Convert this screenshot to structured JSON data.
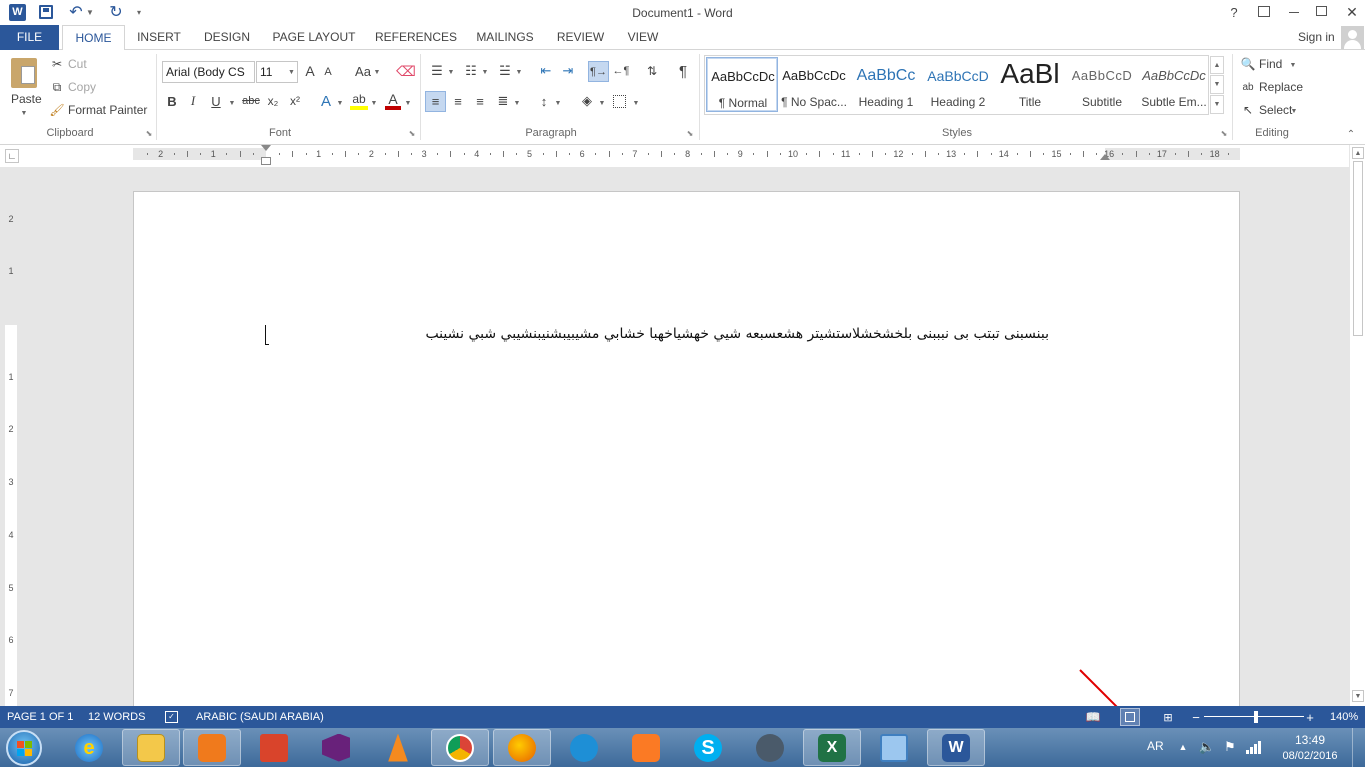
{
  "titlebar": {
    "title": "Document1 - Word",
    "help": "?",
    "sign_in": "Sign in"
  },
  "tabs": [
    "FILE",
    "HOME",
    "INSERT",
    "DESIGN",
    "PAGE LAYOUT",
    "REFERENCES",
    "MAILINGS",
    "REVIEW",
    "VIEW"
  ],
  "clipboard": {
    "paste": "Paste",
    "cut": "Cut",
    "copy": "Copy",
    "format_painter": "Format Painter",
    "label": "Clipboard"
  },
  "font": {
    "family": "Arial (Body CS",
    "size": "11",
    "label": "Font",
    "bold": "B",
    "italic": "I",
    "underline": "U",
    "strike": "abc",
    "subscript": "x₂",
    "superscript": "x²",
    "grow": "A",
    "shrink": "A",
    "case": "Aa",
    "font_color_swatch": "#c00000",
    "highlight_swatch": "#ffff00"
  },
  "paragraph": {
    "label": "Paragraph",
    "pilcrow": "¶"
  },
  "styles": {
    "label": "Styles",
    "items": [
      {
        "sample": "AaBbCcDc",
        "name": "¶ Normal"
      },
      {
        "sample": "AaBbCcDc",
        "name": "¶ No Spac..."
      },
      {
        "sample": "AaBbCc",
        "name": "Heading 1"
      },
      {
        "sample": "AaBbCcD",
        "name": "Heading 2"
      },
      {
        "sample": "AaBl",
        "name": "Title"
      },
      {
        "sample": "AaBbCcD",
        "name": "Subtitle"
      },
      {
        "sample": "AaBbCcDc",
        "name": "Subtle Em..."
      }
    ]
  },
  "editing": {
    "find": "Find",
    "replace": "Replace",
    "select": "Select",
    "label": "Editing"
  },
  "ruler": {
    "numbers": [
      "2",
      "1",
      "1",
      "2",
      "3",
      "4",
      "5",
      "6",
      "7",
      "8",
      "9",
      "10",
      "11",
      "12",
      "13",
      "14",
      "15",
      "16",
      "17",
      "18"
    ],
    "vertical": [
      "2",
      "1",
      "1",
      "2",
      "3",
      "4",
      "5",
      "6",
      "7"
    ]
  },
  "document": {
    "text": "ببنسبنى تبتب بى  نبببنى بلخشخشلاستشيتر  هشعسبعه  شيي خهشياخهبا  خشابي مشيبيبشنيبنشيبي شبي نشينب"
  },
  "status": {
    "page": "PAGE 1 OF 1",
    "words": "12 WORDS",
    "language": "ARABIC (SAUDI ARABIA)",
    "zoom": "140%",
    "zoom_minus": "−",
    "zoom_plus": "+"
  },
  "taskbar": {
    "apps": [
      "windows-explorer",
      "video-player",
      "books",
      "visual-studio",
      "vlc",
      "chrome",
      "firefox",
      "sourcetree",
      "xampp",
      "skype",
      "network-monitor",
      "excel",
      "remote-desktop",
      "word"
    ],
    "lang": "AR",
    "time": "13:49",
    "date": "08/02/2016"
  },
  "colors": {
    "accent": "#2b579a",
    "annotation_arrow": "#e00000"
  }
}
